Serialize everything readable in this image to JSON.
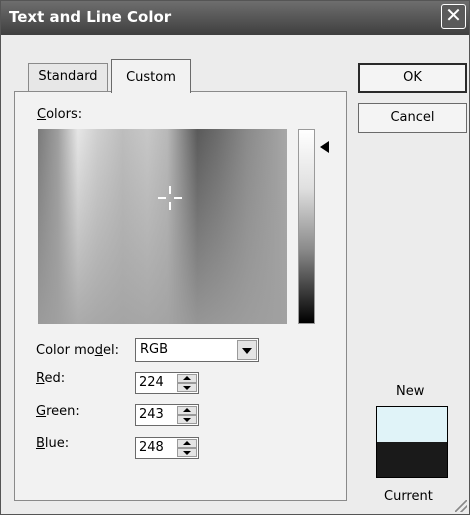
{
  "window": {
    "title": "Text and Line Color",
    "close_glyph": "✕"
  },
  "tabs": [
    {
      "label": "Standard",
      "active": false
    },
    {
      "label": "Custom",
      "active": true
    }
  ],
  "colors_label": {
    "prefix": "",
    "mnemonic": "C",
    "suffix": "olors:"
  },
  "color_model": {
    "label": {
      "prefix": "Color mo",
      "mnemonic": "d",
      "suffix": "el:"
    },
    "value": "RGB"
  },
  "rgb": {
    "red": {
      "prefix": "",
      "mnemonic": "R",
      "suffix": "ed:",
      "value": "224"
    },
    "green": {
      "prefix": "",
      "mnemonic": "G",
      "suffix": "reen:",
      "value": "243"
    },
    "blue": {
      "prefix": "",
      "mnemonic": "B",
      "suffix": "lue:",
      "value": "248"
    }
  },
  "buttons": {
    "ok": "OK",
    "cancel": "Cancel"
  },
  "preview": {
    "new_label": "New",
    "current_label": "Current",
    "new_color": "#e0f3f8",
    "current_color": "#1a1a1a"
  },
  "icons": {
    "close": "close-icon",
    "dropdown": "chevron-down-icon",
    "spin_up": "arrow-up-icon",
    "spin_down": "arrow-down-icon",
    "slider": "triangle-left-icon",
    "crosshair": "crosshair-icon"
  }
}
